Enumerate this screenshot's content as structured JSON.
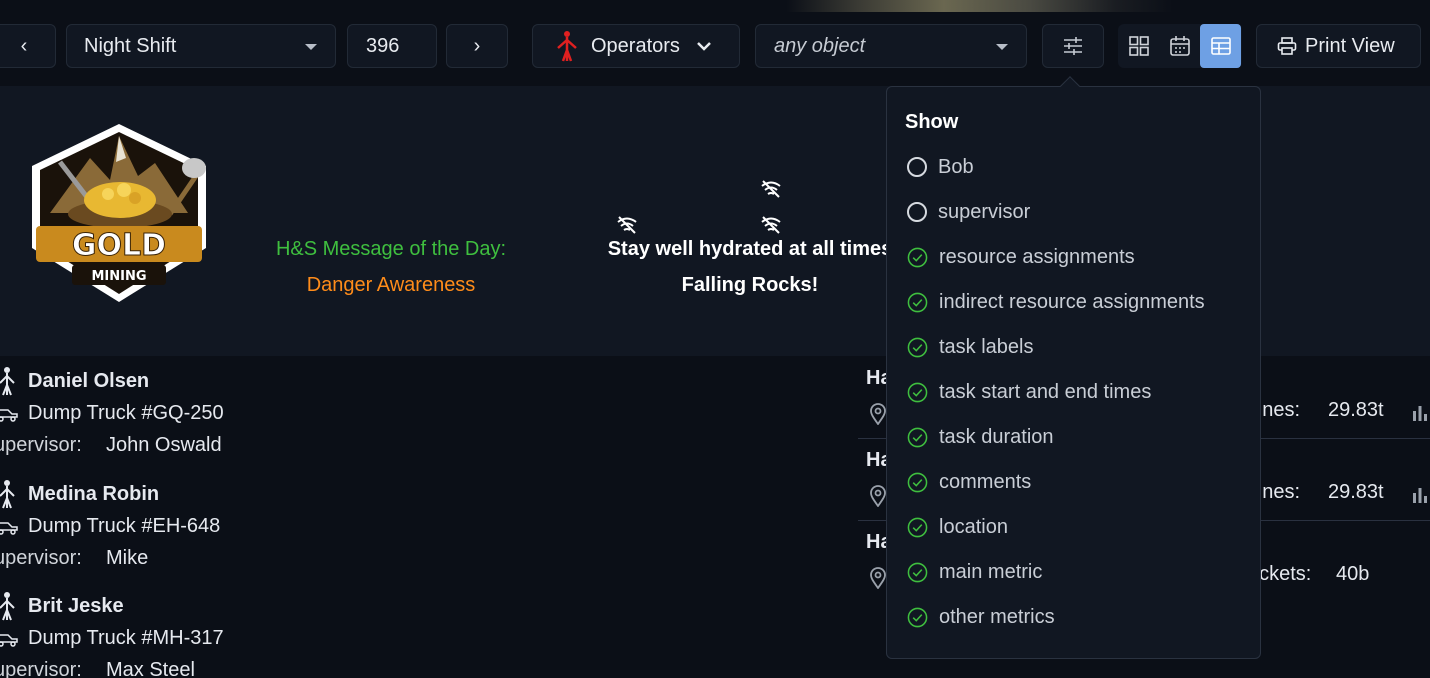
{
  "toolbar": {
    "prev_label": "‹",
    "shift_value": "Night Shift",
    "number_value": "396",
    "next_label": "›",
    "resource_type": "Operators",
    "object_placeholder": "any object",
    "print_label": "Print View",
    "accent_color": "#6ea0e4"
  },
  "header": {
    "logo_text_main": "GOLD",
    "logo_text_sub": "MINING",
    "hs_title": "H&S Message of the Day:",
    "hs_message": "Danger Awareness",
    "hydration_msg": "Stay well hydrated at all times",
    "rocks_msg": "Falling Rocks!",
    "hs_title_color": "#3fbf3f",
    "hs_message_color": "#ff8c1a"
  },
  "people": [
    {
      "name": "Daniel Olsen",
      "vehicle": "Dump Truck #GQ-250",
      "supervisor_label": "upervisor:",
      "supervisor": "John Oswald"
    },
    {
      "name": "Medina Robin",
      "vehicle": "Dump Truck #EH-648",
      "supervisor_label": "upervisor:",
      "supervisor": "Mike"
    },
    {
      "name": "Brit Jeske",
      "vehicle": "Dump Truck #MH-317",
      "supervisor_label": "upervisor:",
      "supervisor": "Max Steel"
    }
  ],
  "tasks": [
    {
      "title_fragment": "Ha",
      "metric_label": "onnes:",
      "metric_value": "29.83t"
    },
    {
      "title_fragment": "Ha",
      "metric_label": "onnes:",
      "metric_value": "29.83t"
    },
    {
      "title_fragment": "Ha",
      "metric_label": "uckets:",
      "metric_value": "40b"
    }
  ],
  "show_panel": {
    "title": "Show",
    "options": [
      {
        "label": "Bob",
        "checked": false
      },
      {
        "label": "supervisor",
        "checked": false
      },
      {
        "label": "resource assignments",
        "checked": true
      },
      {
        "label": "indirect resource assignments",
        "checked": true
      },
      {
        "label": "task labels",
        "checked": true
      },
      {
        "label": "task start and end times",
        "checked": true
      },
      {
        "label": "task duration",
        "checked": true
      },
      {
        "label": "comments",
        "checked": true
      },
      {
        "label": "location",
        "checked": true
      },
      {
        "label": "main metric",
        "checked": true
      },
      {
        "label": "other metrics",
        "checked": true
      }
    ],
    "check_color": "#3fbf3f"
  }
}
